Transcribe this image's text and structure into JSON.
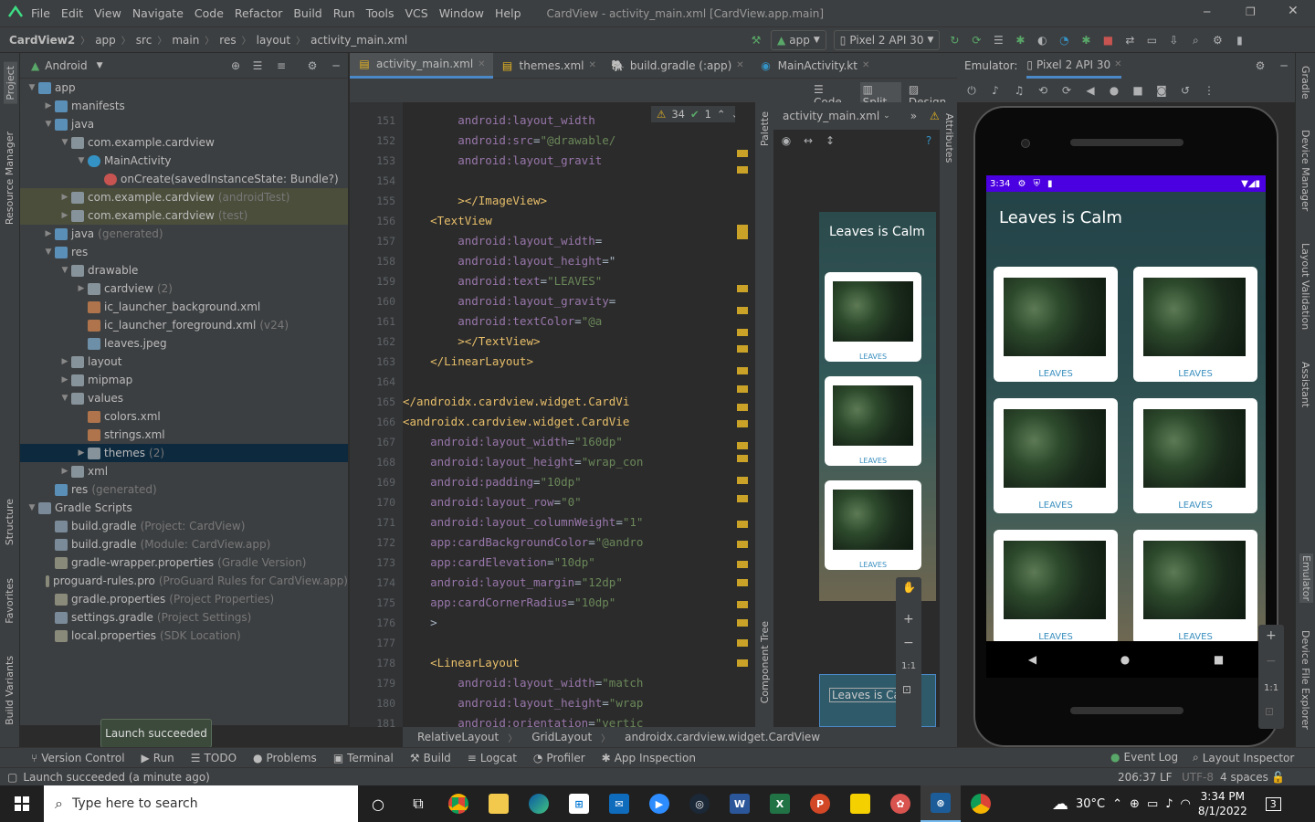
{
  "menu": {
    "items": [
      "File",
      "Edit",
      "View",
      "Navigate",
      "Code",
      "Refactor",
      "Build",
      "Run",
      "Tools",
      "VCS",
      "Window",
      "Help"
    ],
    "title": "CardView - activity_main.xml [CardView.app.main]"
  },
  "nav": {
    "crumbs": [
      "CardView2",
      "app",
      "src",
      "main",
      "res",
      "layout",
      "activity_main.xml"
    ],
    "config": "app",
    "device": "Pixel 2 API 30"
  },
  "project": {
    "view": "Android",
    "tree": [
      {
        "label": "app",
        "extra": "",
        "indent": 0,
        "arrow": "v",
        "icon": "fold b"
      },
      {
        "label": "manifests",
        "extra": "",
        "indent": 1,
        "arrow": ">",
        "icon": "fold b"
      },
      {
        "label": "java",
        "extra": "",
        "indent": 1,
        "arrow": "v",
        "icon": "fold b"
      },
      {
        "label": "com.example.cardview",
        "extra": "",
        "indent": 2,
        "arrow": "v",
        "icon": "fold"
      },
      {
        "label": "MainActivity",
        "extra": "",
        "indent": 3,
        "arrow": "v",
        "icon": "cls"
      },
      {
        "label": "onCreate(savedInstanceState: Bundle?)",
        "extra": "",
        "indent": 4,
        "arrow": "",
        "icon": "meth"
      },
      {
        "label": "com.example.cardview",
        "extra": "(androidTest)",
        "indent": 2,
        "arrow": ">",
        "icon": "fold",
        "hl": true
      },
      {
        "label": "com.example.cardview",
        "extra": "(test)",
        "indent": 2,
        "arrow": ">",
        "icon": "fold",
        "hl": true
      },
      {
        "label": "java",
        "extra": "(generated)",
        "indent": 1,
        "arrow": ">",
        "icon": "fold b"
      },
      {
        "label": "res",
        "extra": "",
        "indent": 1,
        "arrow": "v",
        "icon": "fold b"
      },
      {
        "label": "drawable",
        "extra": "",
        "indent": 2,
        "arrow": "v",
        "icon": "fold"
      },
      {
        "label": "cardview",
        "extra": "(2)",
        "indent": 3,
        "arrow": ">",
        "icon": "fold"
      },
      {
        "label": "ic_launcher_background.xml",
        "extra": "",
        "indent": 3,
        "arrow": "",
        "icon": "xml"
      },
      {
        "label": "ic_launcher_foreground.xml",
        "extra": "(v24)",
        "indent": 3,
        "arrow": "",
        "icon": "xml"
      },
      {
        "label": "leaves.jpeg",
        "extra": "",
        "indent": 3,
        "arrow": "",
        "icon": "img"
      },
      {
        "label": "layout",
        "extra": "",
        "indent": 2,
        "arrow": ">",
        "icon": "fold"
      },
      {
        "label": "mipmap",
        "extra": "",
        "indent": 2,
        "arrow": ">",
        "icon": "fold"
      },
      {
        "label": "values",
        "extra": "",
        "indent": 2,
        "arrow": "v",
        "icon": "fold"
      },
      {
        "label": "colors.xml",
        "extra": "",
        "indent": 3,
        "arrow": "",
        "icon": "xml"
      },
      {
        "label": "strings.xml",
        "extra": "",
        "indent": 3,
        "arrow": "",
        "icon": "xml"
      },
      {
        "label": "themes",
        "extra": "(2)",
        "indent": 3,
        "arrow": ">",
        "icon": "fold",
        "sel": true
      },
      {
        "label": "xml",
        "extra": "",
        "indent": 2,
        "arrow": ">",
        "icon": "fold"
      },
      {
        "label": "res",
        "extra": "(generated)",
        "indent": 1,
        "arrow": "",
        "icon": "fold b"
      },
      {
        "label": "Gradle Scripts",
        "extra": "",
        "indent": 0,
        "arrow": "v",
        "icon": "gradle"
      },
      {
        "label": "build.gradle",
        "extra": "(Project: CardView)",
        "indent": 1,
        "arrow": "",
        "icon": "gradle"
      },
      {
        "label": "build.gradle",
        "extra": "(Module: CardView.app)",
        "indent": 1,
        "arrow": "",
        "icon": "gradle"
      },
      {
        "label": "gradle-wrapper.properties",
        "extra": "(Gradle Version)",
        "indent": 1,
        "arrow": "",
        "icon": "prop"
      },
      {
        "label": "proguard-rules.pro",
        "extra": "(ProGuard Rules for CardView.app)",
        "indent": 1,
        "arrow": "",
        "icon": "prop"
      },
      {
        "label": "gradle.properties",
        "extra": "(Project Properties)",
        "indent": 1,
        "arrow": "",
        "icon": "prop"
      },
      {
        "label": "settings.gradle",
        "extra": "(Project Settings)",
        "indent": 1,
        "arrow": "",
        "icon": "gradle"
      },
      {
        "label": "local.properties",
        "extra": "(SDK Location)",
        "indent": 1,
        "arrow": "",
        "icon": "prop"
      }
    ]
  },
  "tabs": [
    "activity_main.xml",
    "themes.xml",
    "build.gradle (:app)",
    "MainActivity.kt"
  ],
  "editor": {
    "modes": [
      "Code",
      "Split",
      "Design"
    ],
    "warnings": "34",
    "ok": "1",
    "file": "activity_main.xml",
    "lines": [
      {
        "n": "151",
        "t": [
          [
            "at",
            "        android:"
          ],
          [
            "at",
            "layout_width"
          ]
        ]
      },
      {
        "n": "152",
        "t": [
          [
            "at",
            "        android:"
          ],
          [
            "at",
            "src"
          ],
          [
            "txt",
            "="
          ],
          [
            "vl",
            "\"@drawable/"
          ]
        ]
      },
      {
        "n": "153",
        "t": [
          [
            "at",
            "        android:"
          ],
          [
            "at",
            "layout_gravit"
          ]
        ]
      },
      {
        "n": "154",
        "t": [
          [
            "txt",
            ""
          ]
        ]
      },
      {
        "n": "155",
        "t": [
          [
            "tg",
            "        ></ImageView>"
          ]
        ]
      },
      {
        "n": "156",
        "t": [
          [
            "tg",
            "    <TextView"
          ]
        ]
      },
      {
        "n": "157",
        "t": [
          [
            "at",
            "        android:"
          ],
          [
            "at",
            "layout_width"
          ],
          [
            "txt",
            "="
          ]
        ]
      },
      {
        "n": "158",
        "t": [
          [
            "at",
            "        android:"
          ],
          [
            "at",
            "layout_height"
          ],
          [
            "txt",
            "=\""
          ]
        ]
      },
      {
        "n": "159",
        "t": [
          [
            "at",
            "        android:"
          ],
          [
            "at",
            "text"
          ],
          [
            "txt",
            "="
          ],
          [
            "vl",
            "\"LEAVES\""
          ]
        ]
      },
      {
        "n": "160",
        "t": [
          [
            "at",
            "        android:"
          ],
          [
            "at",
            "layout_gravity"
          ],
          [
            "txt",
            "="
          ]
        ]
      },
      {
        "n": "161",
        "t": [
          [
            "at",
            "        android:"
          ],
          [
            "at",
            "textColor"
          ],
          [
            "txt",
            "="
          ],
          [
            "vl",
            "\"@a"
          ]
        ]
      },
      {
        "n": "162",
        "t": [
          [
            "tg",
            "        ></TextView>"
          ]
        ]
      },
      {
        "n": "163",
        "t": [
          [
            "tg",
            "    </LinearLayout>"
          ]
        ]
      },
      {
        "n": "164",
        "t": [
          [
            "txt",
            ""
          ]
        ]
      },
      {
        "n": "165",
        "t": [
          [
            "tg",
            "</androidx.cardview.widget.CardVi"
          ]
        ]
      },
      {
        "n": "166",
        "t": [
          [
            "tg",
            "<androidx.cardview.widget.CardVie"
          ]
        ]
      },
      {
        "n": "167",
        "t": [
          [
            "at",
            "    android:"
          ],
          [
            "at",
            "layout_width"
          ],
          [
            "txt",
            "="
          ],
          [
            "vl",
            "\"160dp\""
          ]
        ]
      },
      {
        "n": "168",
        "t": [
          [
            "at",
            "    android:"
          ],
          [
            "at",
            "layout_height"
          ],
          [
            "txt",
            "="
          ],
          [
            "vl",
            "\"wrap_con"
          ]
        ]
      },
      {
        "n": "169",
        "t": [
          [
            "at",
            "    android:"
          ],
          [
            "at",
            "padding"
          ],
          [
            "txt",
            "="
          ],
          [
            "vl",
            "\"10dp\""
          ]
        ]
      },
      {
        "n": "170",
        "t": [
          [
            "at",
            "    android:"
          ],
          [
            "at",
            "layout_row"
          ],
          [
            "txt",
            "="
          ],
          [
            "vl",
            "\"0\""
          ]
        ]
      },
      {
        "n": "171",
        "t": [
          [
            "at",
            "    android:"
          ],
          [
            "at",
            "layout_columnWeight"
          ],
          [
            "txt",
            "="
          ],
          [
            "vl",
            "\"1\""
          ]
        ]
      },
      {
        "n": "172",
        "t": [
          [
            "at",
            "    app:"
          ],
          [
            "at",
            "cardBackgroundColor"
          ],
          [
            "txt",
            "="
          ],
          [
            "vl",
            "\"@andro"
          ]
        ]
      },
      {
        "n": "173",
        "t": [
          [
            "at",
            "    app:"
          ],
          [
            "at",
            "cardElevation"
          ],
          [
            "txt",
            "="
          ],
          [
            "vl",
            "\"10dp\""
          ]
        ]
      },
      {
        "n": "174",
        "t": [
          [
            "at",
            "    android:"
          ],
          [
            "at",
            "layout_margin"
          ],
          [
            "txt",
            "="
          ],
          [
            "vl",
            "\"12dp\""
          ]
        ]
      },
      {
        "n": "175",
        "t": [
          [
            "at",
            "    app:"
          ],
          [
            "at",
            "cardCornerRadius"
          ],
          [
            "txt",
            "="
          ],
          [
            "vl",
            "\"10dp\""
          ]
        ]
      },
      {
        "n": "176",
        "t": [
          [
            "txt",
            "    >"
          ]
        ]
      },
      {
        "n": "177",
        "t": [
          [
            "txt",
            ""
          ]
        ]
      },
      {
        "n": "178",
        "t": [
          [
            "tg",
            "    <LinearLayout"
          ]
        ]
      },
      {
        "n": "179",
        "t": [
          [
            "at",
            "        android:"
          ],
          [
            "at",
            "layout_width"
          ],
          [
            "txt",
            "="
          ],
          [
            "vl",
            "\"match"
          ]
        ]
      },
      {
        "n": "180",
        "t": [
          [
            "at",
            "        android:"
          ],
          [
            "at",
            "layout_height"
          ],
          [
            "txt",
            "="
          ],
          [
            "vl",
            "\"wrap"
          ]
        ]
      },
      {
        "n": "181",
        "t": [
          [
            "at",
            "        android:"
          ],
          [
            "at",
            "orientation"
          ],
          [
            "txt",
            "="
          ],
          [
            "vl",
            "\"vertic"
          ]
        ]
      }
    ]
  },
  "design": {
    "file": "activity_main.xml",
    "title": "Leaves is Calm",
    "card_label": "LEAVES",
    "preview_text": "Leaves is Ca",
    "zoom": "1:1"
  },
  "side_labels": {
    "left": [
      "Project",
      "Resource Manager",
      "Structure",
      "Favorites",
      "Build Variants"
    ],
    "right": [
      "Gradle",
      "Device Manager",
      "Layout Validation",
      "Assistant",
      "Emulator",
      "Device File Explorer"
    ],
    "palette": "Palette",
    "component_tree": "Component Tree",
    "attributes": "Attributes"
  },
  "emulator": {
    "label": "Emulator:",
    "device": "Pixel 2 API 30",
    "time": "3:34",
    "app_title": "Leaves is Calm",
    "card_label": "LEAVES",
    "zoom": "1:1"
  },
  "breadcrumb2": [
    "RelativeLayout",
    "GridLayout",
    "androidx.cardview.widget.CardView"
  ],
  "bottom_tools": [
    "Version Control",
    "Run",
    "TODO",
    "Problems",
    "Terminal",
    "Build",
    "Logcat",
    "Profiler",
    "App Inspection"
  ],
  "bottom_right": [
    "Event Log",
    "Layout Inspector"
  ],
  "status": {
    "message": "Launch succeeded (a minute ago)",
    "toast": "Launch succeeded",
    "pos": "206:37",
    "le": "LF",
    "enc": "UTF-8",
    "indent": "4 spaces"
  },
  "taskbar": {
    "search_placeholder": "Type here to search",
    "temp": "30°C",
    "time": "3:34 PM",
    "date": "8/1/2022",
    "notif": "3"
  }
}
